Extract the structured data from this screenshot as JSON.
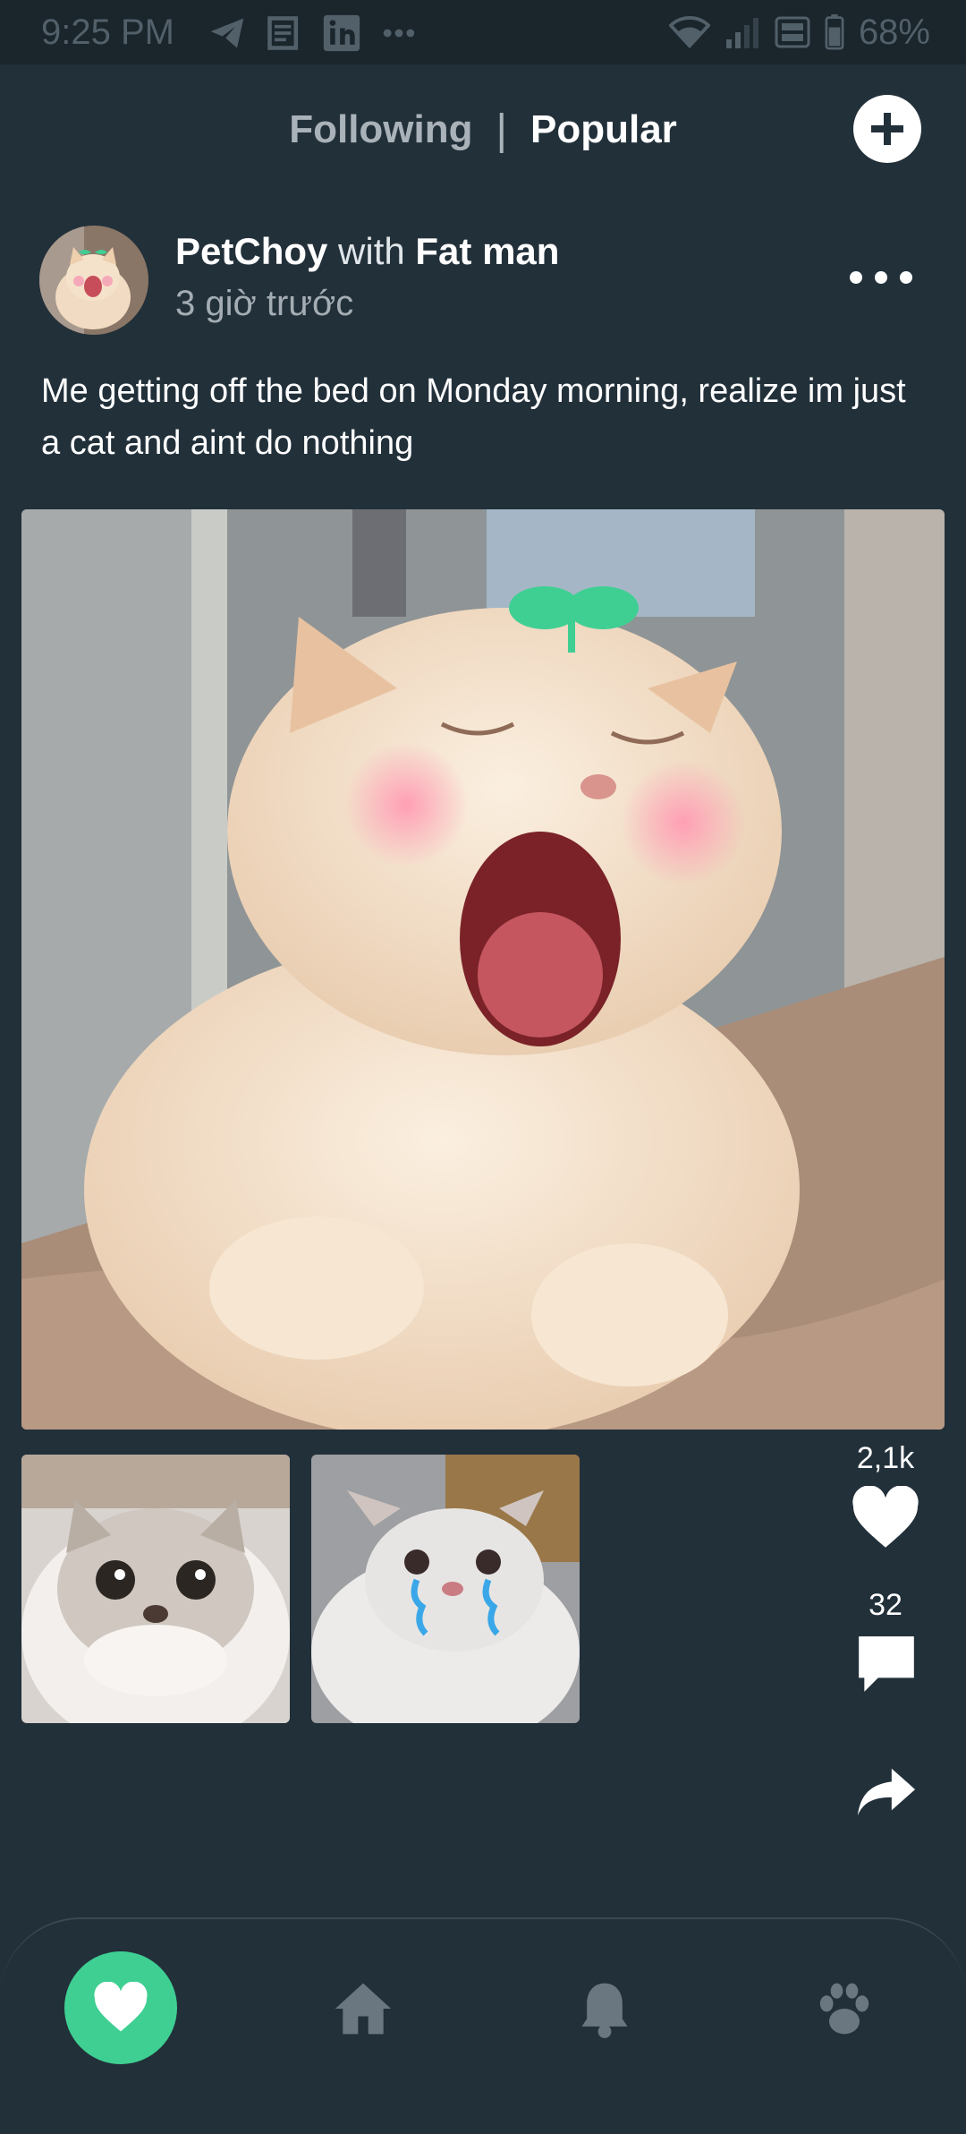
{
  "status_bar": {
    "time": "9:25 PM",
    "battery": "68%",
    "left_icons": [
      "telegram-icon",
      "news-icon",
      "linkedin-icon",
      "more-dots-icon"
    ],
    "right_icons": [
      "wifi-icon",
      "signal-icon",
      "volte-icon",
      "battery-icon"
    ]
  },
  "top_tabs": {
    "following": "Following",
    "separator": "|",
    "popular": "Popular",
    "active": "Popular"
  },
  "post": {
    "author": "PetChoy",
    "with_word": "with",
    "tagged": "Fat man",
    "time": "3 giờ trước",
    "caption": "Me getting off the bed on Monday morning, realize im just a cat and aint do nothing",
    "likes": "2,1k",
    "comments": "32"
  },
  "colors": {
    "background": "#22303a",
    "accent": "#3fcf93",
    "muted_text": "#a4adb3"
  },
  "bottom_nav": {
    "items": [
      "heart-icon",
      "home-icon",
      "bell-icon",
      "paw-icon"
    ],
    "active": "heart-icon"
  }
}
